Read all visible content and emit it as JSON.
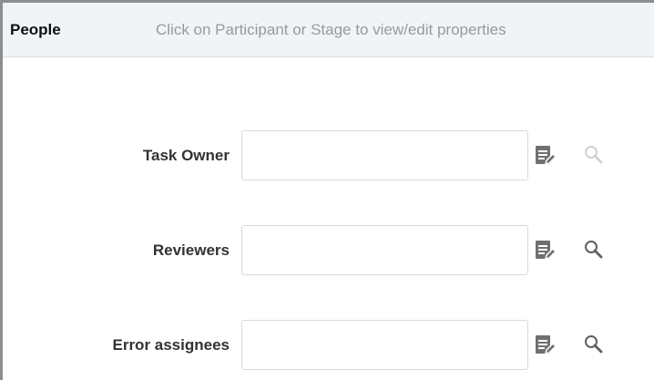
{
  "header": {
    "title": "People",
    "hint": "Click on Participant or Stage to view/edit properties"
  },
  "fields": [
    {
      "label": "Task Owner",
      "value": "",
      "placeholder": "",
      "edit_icon": "edit-list-icon",
      "search_icon": "search-icon",
      "search_enabled": false
    },
    {
      "label": "Reviewers",
      "value": "",
      "placeholder": "",
      "edit_icon": "edit-list-icon",
      "search_icon": "search-icon",
      "search_enabled": true
    },
    {
      "label": "Error assignees",
      "value": "",
      "placeholder": "",
      "edit_icon": "edit-list-icon",
      "search_icon": "search-icon",
      "search_enabled": true
    }
  ],
  "colors": {
    "header_bg": "#f1f4f7",
    "icon": "#6f6f6f",
    "border": "#d5dbe2"
  }
}
